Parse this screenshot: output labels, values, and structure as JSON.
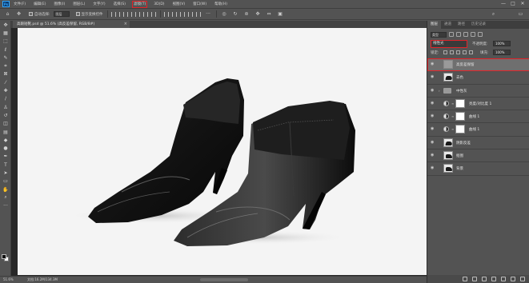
{
  "app": {
    "logo": "Ps"
  },
  "menubar": {
    "items": [
      {
        "label": "文件(F)",
        "highlight": false
      },
      {
        "label": "编辑(E)",
        "highlight": false
      },
      {
        "label": "图像(I)",
        "highlight": false
      },
      {
        "label": "图层(L)",
        "highlight": false
      },
      {
        "label": "文字(Y)",
        "highlight": false
      },
      {
        "label": "选择(S)",
        "highlight": false
      },
      {
        "label": "滤镜(T)",
        "highlight": true
      },
      {
        "label": "3D(D)",
        "highlight": false
      },
      {
        "label": "视图(V)",
        "highlight": false
      },
      {
        "label": "窗口(W)",
        "highlight": false
      },
      {
        "label": "帮助(H)",
        "highlight": false
      }
    ],
    "window_controls": [
      "—",
      "□",
      "✕"
    ]
  },
  "options": {
    "auto_select_label": "自动选择:",
    "auto_select_value": "图层",
    "show_transform_label": "显示变换控件"
  },
  "document": {
    "tab_title": "高跟短靴.psd @ 51.6% (高反差保留, RGB/8#)",
    "close": "×",
    "zoom": "51.6%",
    "doc_info": "文档:16.2M/134.3M"
  },
  "layers_panel": {
    "tabs": [
      "图层",
      "通道",
      "路径",
      "历史记录"
    ],
    "active_tab": 0,
    "kind_label": "类型",
    "blend_mode": "线性光",
    "opacity_label": "不透明度:",
    "opacity": "100%",
    "lock_label": "锁定:",
    "fill_label": "填充:",
    "fill": "100%",
    "layers": [
      {
        "name": "高反差保留",
        "thumb": "empty",
        "selected": true,
        "highlight": true,
        "kind": "pixel"
      },
      {
        "name": "去色",
        "thumb": "dark",
        "selected": false,
        "highlight": false,
        "kind": "pixel"
      },
      {
        "name": "中性灰",
        "thumb": "empty",
        "selected": false,
        "highlight": false,
        "kind": "group"
      },
      {
        "name": "亮度/对比度 1",
        "thumb": "adjust",
        "selected": false,
        "highlight": false,
        "kind": "adjustment"
      },
      {
        "name": "曲线 1",
        "thumb": "mask",
        "selected": false,
        "highlight": false,
        "kind": "adjustment"
      },
      {
        "name": "曲线 1",
        "thumb": "mask",
        "selected": false,
        "highlight": false,
        "kind": "adjustment"
      },
      {
        "name": "阴影反差",
        "thumb": "dark",
        "selected": false,
        "highlight": false,
        "kind": "pixel"
      },
      {
        "name": "抠图",
        "thumb": "shoe",
        "selected": false,
        "highlight": false,
        "kind": "pixel"
      },
      {
        "name": "背景",
        "thumb": "shoe",
        "selected": false,
        "highlight": false,
        "kind": "pixel"
      }
    ]
  },
  "tools": [
    "move-icon",
    "artboard-icon",
    "marquee-icon",
    "lasso-icon",
    "quick-select-icon",
    "crop-icon",
    "frame-icon",
    "eyedropper-icon",
    "healing-icon",
    "brush-icon",
    "clone-stamp-icon",
    "history-brush-icon",
    "eraser-icon",
    "gradient-icon",
    "blur-icon",
    "dodge-icon",
    "pen-icon",
    "type-icon",
    "path-select-icon",
    "rectangle-icon",
    "hand-icon",
    "zoom-icon",
    "more-icon"
  ]
}
